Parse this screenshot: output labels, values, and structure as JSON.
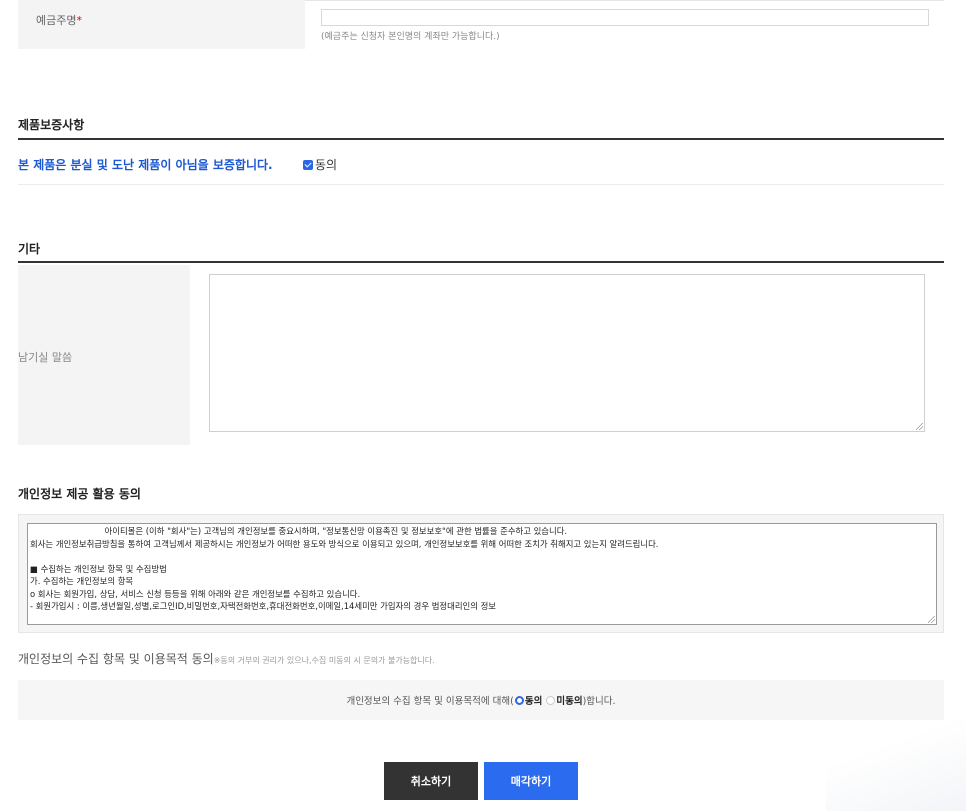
{
  "depositor": {
    "label": "예금주명",
    "required_mark": "*",
    "value": "",
    "note": "(예금주는 신청자 본인명의 계좌만 가능합니다.)"
  },
  "warranty": {
    "title": "제품보증사항",
    "statement": "본 제품은 분실 및 도난 제품이 아님을 보증합니다.",
    "agree_label": "동의",
    "agree_checked": true
  },
  "etc": {
    "title": "기타",
    "message_label": "남기실 말씀",
    "message_value": ""
  },
  "privacy": {
    "title": "개인정보 제공 활용 동의",
    "lines": [
      "                            아이티몰은 (이하 \"회사\"는) 고객님의 개인정보를 중요시하며, \"정보통신망 이용촉진 및 정보보호\"에 관한 법률을 준수하고 있습니다.",
      "회사는 개인정보취급방침을 통하여 고객님께서 제공하시는 개인정보가 어떠한 용도와 방식으로 이용되고 있으며, 개인정보보호를 위해 어떠한 조치가 취해지고 있는지 알려드립니다.",
      "",
      "■ 수집하는 개인정보 항목 및 수집방법",
      "가. 수집하는 개인정보의 항목",
      "o 회사는 회원가입, 상담, 서비스 신청 등등을 위해 아래와 같은 개인정보를 수집하고 있습니다.",
      "- 회원가입시 : 이름,생년월일,성별,로그인ID,비밀번호,자택전화번호,휴대전화번호,이메일,14세미만 가입자의 경우 법정대리인의 정보"
    ]
  },
  "consent": {
    "title": "개인정보의 수집 항목 및 이용목적 동의",
    "note": "※동의 거부의 권리가 있으나,수집 미동의 시 문의가 불가능합니다.",
    "prefix": "개인정보의 수집 항목 및 이용목적에 대해(",
    "agree": "동의",
    "disagree": "미동의",
    "suffix": ")합니다.",
    "selected": "agree"
  },
  "buttons": {
    "cancel": "취소하기",
    "sell": "매각하기"
  },
  "colors": {
    "accent": "#2b6bf0",
    "warranty_text": "#1b58d2",
    "cancel_button": "#333333",
    "required": "#d9000b"
  }
}
